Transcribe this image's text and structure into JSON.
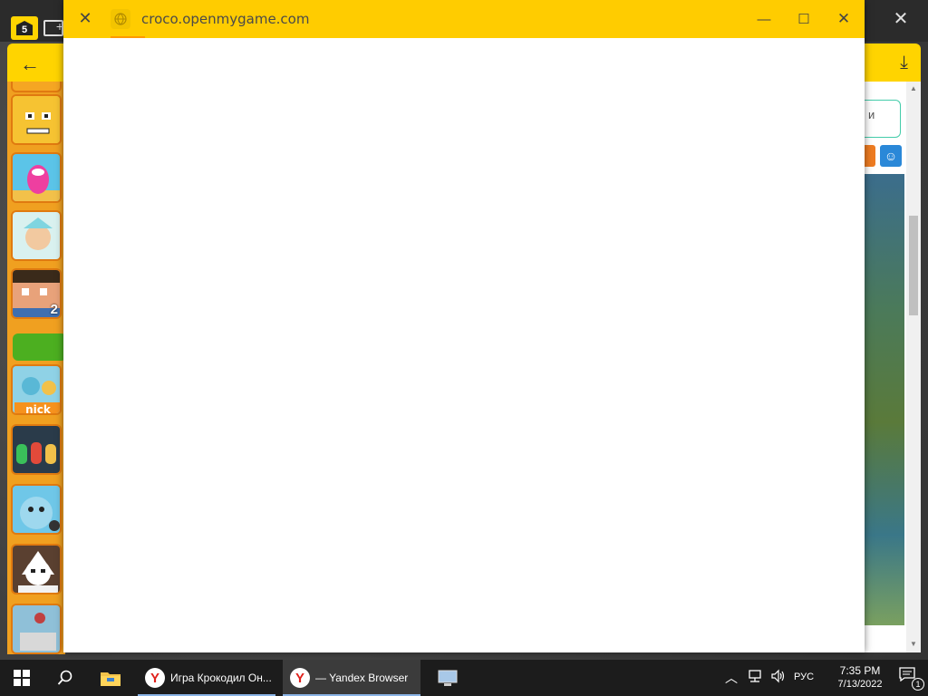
{
  "background_browser": {
    "tab_count": "5",
    "game_badge": "2",
    "search_partial": "и"
  },
  "popup": {
    "url": "croco.openmygame.com",
    "min_glyph": "—",
    "max_glyph": "☐",
    "close_glyph": "✕",
    "close_tab_glyph": "✕"
  },
  "taskbar": {
    "items": [
      {
        "label": "Игра Крокодил Он...",
        "icon": "yandex-browser-icon"
      },
      {
        "label": "— Yandex Browser",
        "icon": "yandex-browser-icon"
      }
    ],
    "language": "РУС",
    "time": "7:35 PM",
    "date": "7/13/2022",
    "notification_count": "1"
  },
  "colors": {
    "yandex_yellow": "#ffcc00",
    "taskbar_bg": "#1c1c1c",
    "game_strip": "#f0a020"
  }
}
